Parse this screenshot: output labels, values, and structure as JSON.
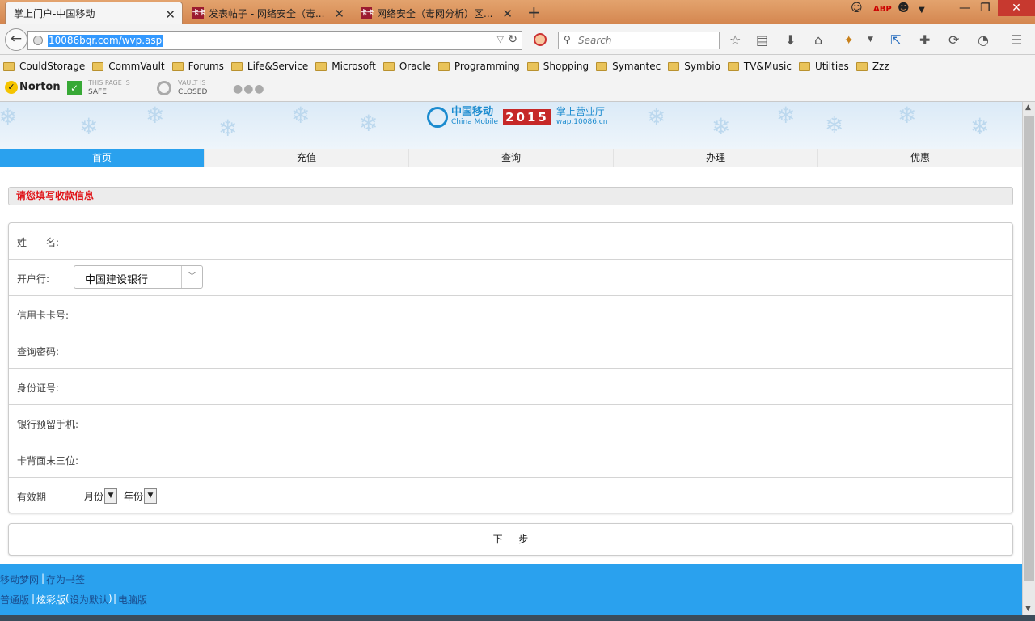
{
  "tabs": [
    {
      "title": "掌上门户-中国移动",
      "active": true
    },
    {
      "title": "发表帖子 - 网络安全（毒...",
      "active": false
    },
    {
      "title": "网络安全（毒网分析）区...",
      "active": false
    }
  ],
  "favicon_text": "卡卡",
  "new_tab": "+",
  "window_controls": {
    "minimize": "—",
    "restore": "❐",
    "close": "✕"
  },
  "toolbar": {
    "url": "10086bqr.com/wvp.asp",
    "search_placeholder": "Search",
    "icons": [
      "back-icon",
      "globe-icon",
      "dropdown-icon",
      "reload-icon",
      "noscript-icon",
      "search-icon",
      "star-icon",
      "reader-icon",
      "download-icon",
      "home-icon",
      "extension-icon",
      "menu-icon"
    ]
  },
  "bookmarks": [
    "CouldStorage",
    "CommVault",
    "Forums",
    "Life&Service",
    "Microsoft",
    "Oracle",
    "Programming",
    "Shopping",
    "Symantec",
    "Symbio",
    "TV&Music",
    "Utilties",
    "Zzz"
  ],
  "norton": {
    "brand": "Norton",
    "safe_line1": "THIS PAGE IS",
    "safe_line2": "SAFE",
    "vault_line1": "VAULT IS",
    "vault_line2": "CLOSED",
    "more": "●●●"
  },
  "banner": {
    "brand_cn": "中国移动",
    "brand_en": "China Mobile",
    "year": "2015",
    "hall": "掌上营业厅",
    "site": "wap.10086.cn"
  },
  "nav_tabs": [
    "首页",
    "充值",
    "查询",
    "办理",
    "优惠"
  ],
  "info_header": "请您填写收款信息",
  "form": {
    "name_label": "姓　　名:",
    "bank_label": "开户行:",
    "bank_value": "中国建设银行",
    "card_label": "信用卡卡号:",
    "password_label": "查询密码:",
    "id_label": "身份证号:",
    "phone_label": "银行预留手机:",
    "cvv_label": "卡背面末三位:",
    "expiry_label": "有效期",
    "month_label": "月份",
    "year_label": "年份"
  },
  "next_button": "下 一 步",
  "footer": {
    "dream": "移动梦网",
    "bookmark": "存为书签",
    "standard": "普通版",
    "color": "炫彩版",
    "set_default": "设为默认",
    "pc": "电脑版",
    "sep": "|"
  },
  "colors": {
    "accent": "#2aa1ee",
    "warning": "#e0161b",
    "chrome": "#d88c55"
  }
}
